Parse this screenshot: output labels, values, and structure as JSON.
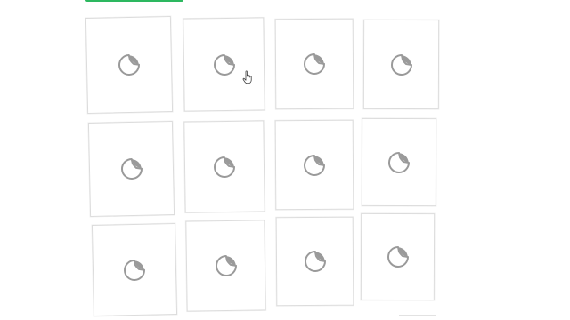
{
  "page": {
    "accent_color": "#2db860",
    "tile_border_color": "#dcdcdc",
    "icon_color": "#9a9a9a"
  },
  "grid": {
    "rows": 3,
    "columns": 4,
    "tile_icon": "sticker-peel-icon",
    "tiles": [
      {
        "row": 1,
        "col": 1,
        "icon": "sticker-peel-icon"
      },
      {
        "row": 1,
        "col": 2,
        "icon": "sticker-peel-icon"
      },
      {
        "row": 1,
        "col": 3,
        "icon": "sticker-peel-icon"
      },
      {
        "row": 1,
        "col": 4,
        "icon": "sticker-peel-icon"
      },
      {
        "row": 2,
        "col": 1,
        "icon": "sticker-peel-icon"
      },
      {
        "row": 2,
        "col": 2,
        "icon": "sticker-peel-icon"
      },
      {
        "row": 2,
        "col": 3,
        "icon": "sticker-peel-icon"
      },
      {
        "row": 2,
        "col": 4,
        "icon": "sticker-peel-icon"
      },
      {
        "row": 3,
        "col": 1,
        "icon": "sticker-peel-icon"
      },
      {
        "row": 3,
        "col": 2,
        "icon": "sticker-peel-icon"
      },
      {
        "row": 3,
        "col": 3,
        "icon": "sticker-peel-icon"
      },
      {
        "row": 3,
        "col": 4,
        "icon": "sticker-peel-icon"
      }
    ]
  },
  "pointer": {
    "icon": "hand-pointer-icon"
  }
}
